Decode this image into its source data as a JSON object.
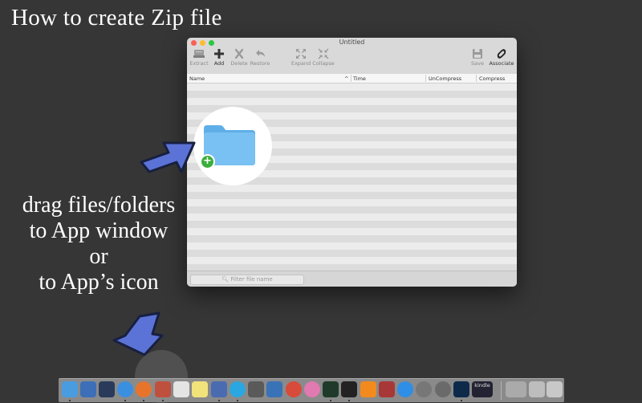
{
  "headline": "How to create Zip file",
  "instructions": [
    "drag files/folders",
    "to App window",
    "or",
    "to App’s icon"
  ],
  "window": {
    "title": "Untitled",
    "toolbar": [
      {
        "key": "extract",
        "label": "Extract",
        "icon": "extract-icon",
        "enabled": false
      },
      {
        "key": "add",
        "label": "Add",
        "icon": "plus-icon",
        "enabled": true
      },
      {
        "key": "delete",
        "label": "Delete",
        "icon": "delete-icon",
        "enabled": false
      },
      {
        "key": "restore",
        "label": "Restore",
        "icon": "restore-icon",
        "enabled": false
      },
      {
        "key": "expand",
        "label": "Expand",
        "icon": "expand-icon",
        "enabled": false
      },
      {
        "key": "collapse",
        "label": "Collapse",
        "icon": "collapse-icon",
        "enabled": false
      },
      {
        "key": "save",
        "label": "Save",
        "icon": "save-icon",
        "enabled": false
      },
      {
        "key": "associate",
        "label": "Associate",
        "icon": "link-icon",
        "enabled": true
      }
    ],
    "columns": [
      "Name",
      "Time",
      "UnCompress",
      "Compress"
    ],
    "sort_indicator": "^",
    "filter_placeholder": "Filter file name"
  },
  "dock": {
    "dock_label": "kindle"
  },
  "colors": {
    "background": "#363636",
    "arrow": "#5b73d6",
    "folder": "#6ab7ef",
    "plus_badge": "#3cae3c"
  }
}
